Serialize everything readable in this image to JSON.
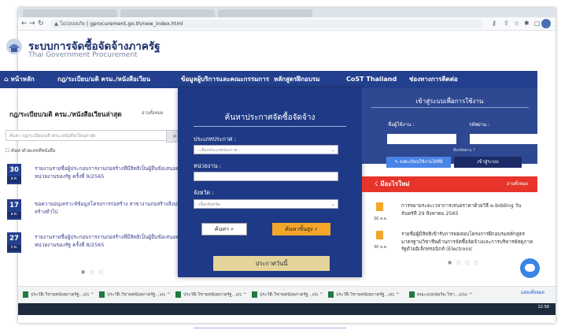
{
  "browser": {
    "security": "ไม่ปลอดภัย",
    "url": "gprocurement.go.th/new_index.html"
  },
  "site": {
    "brand_th": "ระบบการจัดซื้อจัดจ้างภาครัฐ",
    "brand_en": "Thai Government Procurement"
  },
  "nav": {
    "home": "หน้าหลัก",
    "regulations": "กฎ/ระเบียบ/มติ ครม./หนังสือเวียน",
    "services": "ข้อมูลผู้บริการและคณะกรรมการ",
    "courses": "หลักสูตรฝึกอบรม",
    "cost": "CoST Thailand",
    "contact": "ช่องทางการติดต่อ"
  },
  "left": {
    "heading": "กฎ/ระเบียบ/มติ ครม./หนังสือเวียนล่าสุด",
    "view_all": "อ่านทั้งหมด",
    "search_placeholder": "ค้นหา กฎ/ระเบียบ/มติ ครม./หนังสือเวียนล่าสุด",
    "checkbox": "ค้นหาด้วยเลขที่หนังสือ",
    "items": [
      {
        "day": "30",
        "month": "ส.ค.",
        "text": "รายงานรายชื่อผู้ประกอบการงานก่อสร้างที่มีสิทธิเป็นผู้ยื่นข้อเสนอต่อหน่วยงานของรัฐ ครั้งที่ 9/2565"
      },
      {
        "day": "17",
        "month": "ส.ค.",
        "text": "ขอความอนุเคราะห์ข้อมูลโครงการก่อสร้าง สาขางานก่อสร้างสิ่งปลูกสร้างทั่วไป"
      },
      {
        "day": "27",
        "month": "ก.ค.",
        "text": "รายงานรายชื่อผู้ประกอบการงานก่อสร้างที่มีสิทธิเป็นผู้ยื่นข้อเสนอต่อหน่วยงานของรัฐ ครั้งที่ 8/2565"
      }
    ]
  },
  "search_panel": {
    "title": "ค้นหาประกาศจัดซื้อจัดจ้าง",
    "type_label": "ประเภทประกาศ :",
    "type_value": "- เลือกประเภทประกาศ -",
    "agency_label": "หน่วยงาน :",
    "province_label": "จังหวัด :",
    "province_value": "-เลือกจังหวัด-",
    "search_btn": "ค้นหา",
    "advanced_btn": "ค้นหาขั้นสูง",
    "today_btn": "ประกาศวันนี้"
  },
  "login": {
    "title": "เข้าสู่ระบบเพื่อการใช้งาน",
    "user_label": "ชื่อผู้ใช้งาน :",
    "pass_label": "รหัสผ่าน :",
    "forgot": "ลืมรหัสผ่าน ?",
    "register": "ลงทะเบียนใช้งานได้ที่นี่",
    "login_btn": "เข้าสู่ระบบ"
  },
  "whats_new": {
    "title": "มีอะไรใหม่",
    "view_all": "อ่านทั้งหมด",
    "items": [
      {
        "date": "30 ส.ค.",
        "text": "การขยายระยะเวลาการเสนอราคาด้วยวิธี e-bidding วันจันทร์ที่ 29 สิงหาคม 2565"
      },
      {
        "date": "30 ส.ค.",
        "text": "รายชื่อผู้มีสิทธิเข้ารับการทดสอบโครงการฝึกอบรมหลักสูตรมาตรฐานวิชาชีพด้านการจัดซื้อจัดจ้างและการบริหารพัสดุภาครัฐด้วยอิเล็กทรอนิกส์ (Electronic"
      }
    ]
  },
  "downloads": {
    "items": [
      "ประวัติ-วิชาพหนังสภาครัฐ...xls",
      "ประวัติ-วิชาพหนังสภาครัฐ...xls",
      "ประวัติ-วิชาพหนังสภาครัฐ...xls",
      "ประวัติ-วิชาพหนังสภาครัฐ...xls",
      "ประวัติ-วิชาพหนังสภาครัฐ...xls",
      "คณะแบบฟอร์ม-วิชา...xlsx"
    ],
    "show_all": "แสดงทั้งหมด"
  },
  "clock": "22:58"
}
